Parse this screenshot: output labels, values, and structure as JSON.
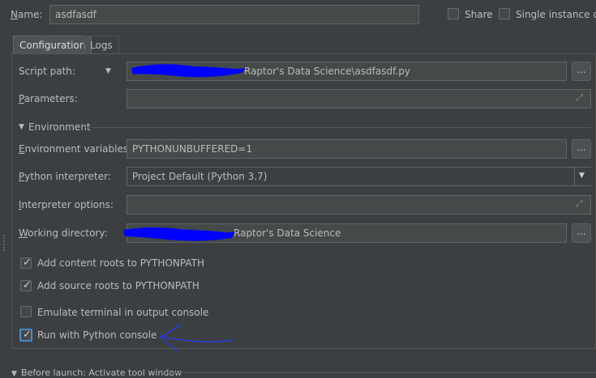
{
  "header": {
    "name_label_prefix": "N",
    "name_label_rest": "ame:",
    "name_value": "asdfasdf",
    "share_label": "Share",
    "single_instance_label": "Single instance onl"
  },
  "tabs": [
    {
      "label": "Configuration",
      "active": true
    },
    {
      "label": "Logs",
      "active": false
    }
  ],
  "form": {
    "script_path_label": "Script path:",
    "script_path_value": "Raptor's Data Science\\asdfasdf.py",
    "parameters_label_prefix": "P",
    "parameters_label_rest": "arameters:",
    "environment_section": "Environment",
    "env_vars_label_prefix": "E",
    "env_vars_label_rest": "nvironment variables:",
    "env_vars_value": "PYTHONUNBUFFERED=1",
    "interpreter_label_prefix": "P",
    "interpreter_label_rest": "ython interpreter:",
    "interpreter_value": "Project Default (Python 3.7)",
    "interp_options_label_prefix": "I",
    "interp_options_label_rest": "nterpreter options:",
    "working_dir_label_prefix": "W",
    "working_dir_label_rest": "orking directory:",
    "working_dir_value": "Raptor's Data Science",
    "ellipsis": "..."
  },
  "options": [
    {
      "label": "Add content roots to PYTHONPATH",
      "checked": true
    },
    {
      "label": "Add source roots to PYTHONPATH",
      "checked": true
    },
    {
      "label": "Emulate terminal in output console",
      "checked": false
    },
    {
      "label": "Run with Python console",
      "checked": true
    }
  ],
  "footer": {
    "before_launch": "Before launch: Activate tool window"
  },
  "colors": {
    "background": "#3c3f41",
    "redaction": "#0000ff",
    "annotation": "#1f3cff"
  }
}
